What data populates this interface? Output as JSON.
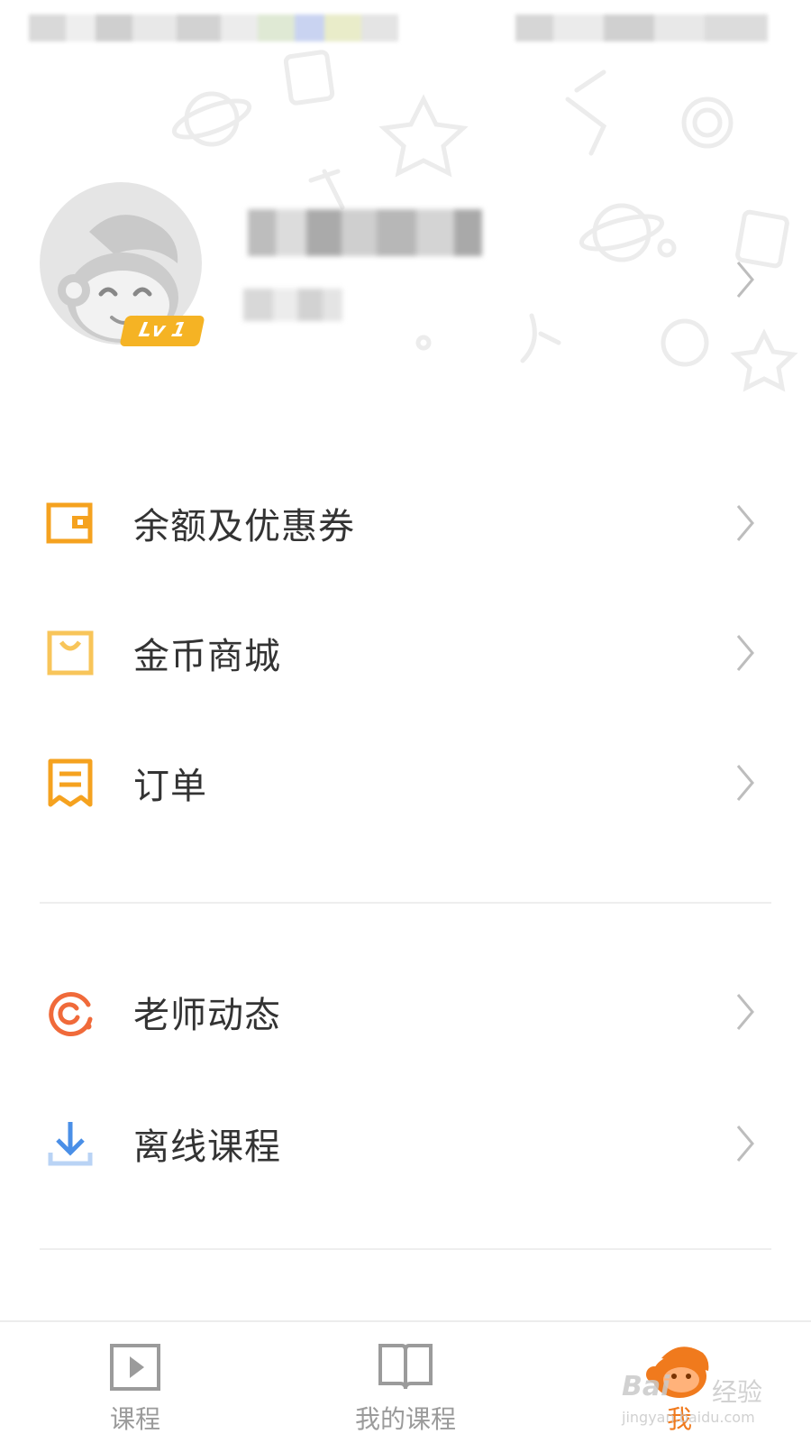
{
  "profile": {
    "level_badge": "Lv 1"
  },
  "menu": {
    "items": [
      {
        "label": "余额及优惠券",
        "icon": "wallet-icon"
      },
      {
        "label": "金币商城",
        "icon": "shopping-bag-icon"
      },
      {
        "label": "订单",
        "icon": "receipt-icon"
      },
      {
        "label": "老师动态",
        "icon": "teacher-feed-icon"
      },
      {
        "label": "离线课程",
        "icon": "download-icon"
      }
    ]
  },
  "tabs": [
    {
      "label": "课程",
      "icon": "video-play-icon",
      "active": false
    },
    {
      "label": "我的课程",
      "icon": "open-book-icon",
      "active": false
    },
    {
      "label": "我",
      "icon": "monkey-mascot-icon",
      "active": true
    }
  ],
  "colors": {
    "accent": "#f07a1d",
    "icon_orange": "#f5a21f",
    "icon_yellow": "#f8c55a",
    "icon_red": "#f06a3a",
    "icon_blue": "#4a8fe7",
    "text": "#333333",
    "tab_inactive": "#9b9b9b"
  },
  "watermark": {
    "brand": "Bai",
    "brand_cn": "经验",
    "url": "jingyan.baidu.com"
  }
}
